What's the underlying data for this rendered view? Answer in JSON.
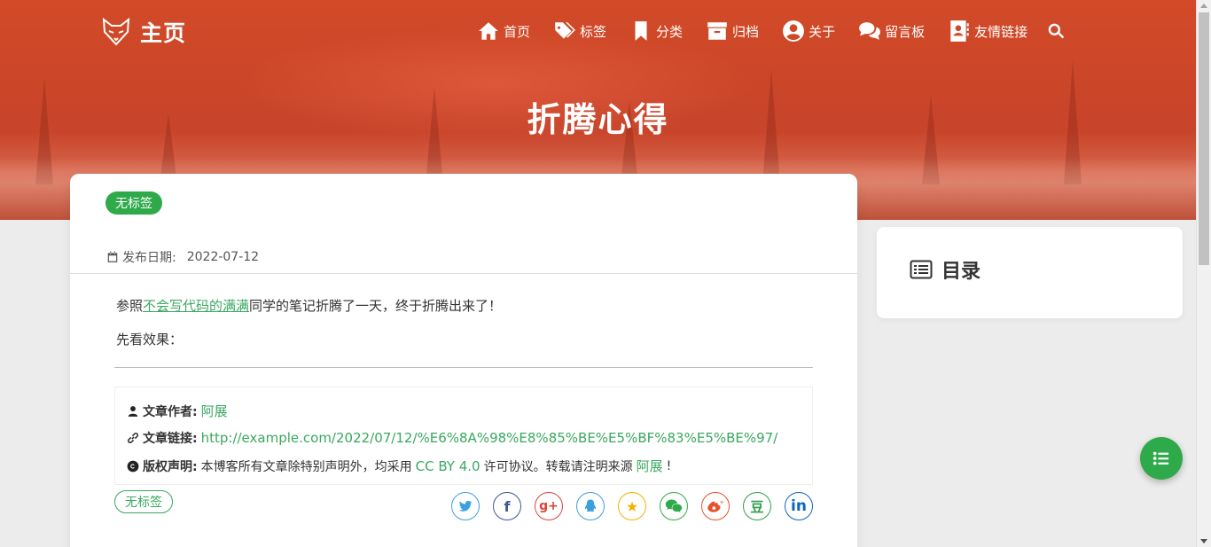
{
  "brand": {
    "title": "主页"
  },
  "nav": [
    {
      "icon": "home-icon",
      "label": "首页"
    },
    {
      "icon": "tags-icon",
      "label": "标签"
    },
    {
      "icon": "bookmark-icon",
      "label": "分类"
    },
    {
      "icon": "archive-icon",
      "label": "归档"
    },
    {
      "icon": "user-circle-icon",
      "label": "关于"
    },
    {
      "icon": "comments-icon",
      "label": "留言板"
    },
    {
      "icon": "address-card-icon",
      "label": "友情链接"
    }
  ],
  "hero": {
    "title": "折腾心得"
  },
  "post": {
    "tag": "无标签",
    "date_label": "发布日期:",
    "date": "2022-07-12",
    "para1_prefix": "参照",
    "para1_link": "不会写代码的满满",
    "para1_suffix": "同学的笔记折腾了一天，终于折腾出来了！",
    "para2": "先看效果："
  },
  "copyright": {
    "author_label": "文章作者:",
    "author": "阿展",
    "link_label": "文章链接:",
    "link": "http://example.com/2022/07/12/%E6%8A%98%E8%85%BE%E5%BF%83%E5%BE%97/",
    "license_label": "版权声明:",
    "license_prefix": "本博客所有文章除特别声明外，均采用",
    "license_name": "CC BY 4.0",
    "license_mid": "许可协议。转载请注明来源",
    "license_author": "阿展",
    "license_suffix": "!"
  },
  "footer_tag": "无标签",
  "share": [
    {
      "icon": "twitter-icon",
      "glyph": "",
      "color": "#3ba0e0"
    },
    {
      "icon": "facebook-icon",
      "glyph": "f",
      "color": "#3b5998"
    },
    {
      "icon": "google-plus-icon",
      "glyph": "g+",
      "color": "#db4437"
    },
    {
      "icon": "qq-icon",
      "glyph": "",
      "color": "#3ba0e0"
    },
    {
      "icon": "qzone-icon",
      "glyph": "★",
      "color": "#f5b000"
    },
    {
      "icon": "wechat-icon",
      "glyph": "",
      "color": "#2eaa4a"
    },
    {
      "icon": "weibo-icon",
      "glyph": "",
      "color": "#e6522c"
    },
    {
      "icon": "douban-icon",
      "glyph": "豆",
      "color": "#2e9e4a"
    },
    {
      "icon": "linkedin-icon",
      "glyph": "in",
      "color": "#0a66c2"
    }
  ],
  "toc": {
    "title": "目录"
  },
  "colors": {
    "accent": "#2eaa4a",
    "hero": "#cc4b2d",
    "link": "#3aa860"
  }
}
